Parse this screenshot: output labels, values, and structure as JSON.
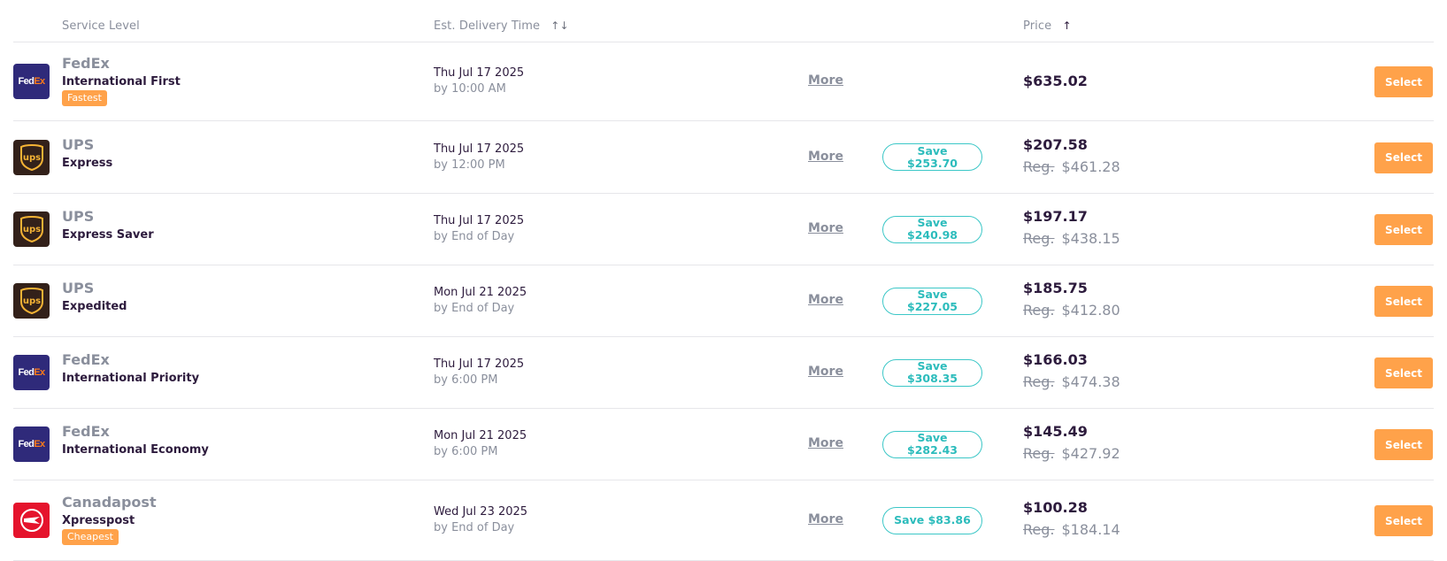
{
  "header": {
    "service_level": "Service Level",
    "est_delivery": "Est. Delivery Time",
    "delivery_sort_icon": "↑↓",
    "price": "Price",
    "price_sort_icon": "↑"
  },
  "colors": {
    "accent_orange": "#ffa24a",
    "save_teal": "#3cc7c7",
    "fedex_purple": "#2f2a7a",
    "ups_brown": "#33211a",
    "canadapost_red": "#e5132c"
  },
  "rows": [
    {
      "carrier": "FedEx",
      "logo": "fedex-logo",
      "service": "International First",
      "badge": "Fastest",
      "date": "Thu Jul 17 2025",
      "time": "by 10:00 AM",
      "more": "More",
      "save": "",
      "price": "$635.02",
      "reg_label": "",
      "reg_price": "",
      "select": "Select"
    },
    {
      "carrier": "UPS",
      "logo": "ups-logo",
      "service": "Express",
      "badge": "",
      "date": "Thu Jul 17 2025",
      "time": "by 12:00 PM",
      "more": "More",
      "save": "Save $253.70",
      "price": "$207.58",
      "reg_label": "Reg.",
      "reg_price": "$461.28",
      "select": "Select"
    },
    {
      "carrier": "UPS",
      "logo": "ups-logo",
      "service": "Express Saver",
      "badge": "",
      "date": "Thu Jul 17 2025",
      "time": "by End of Day",
      "more": "More",
      "save": "Save $240.98",
      "price": "$197.17",
      "reg_label": "Reg.",
      "reg_price": "$438.15",
      "select": "Select"
    },
    {
      "carrier": "UPS",
      "logo": "ups-logo",
      "service": "Expedited",
      "badge": "",
      "date": "Mon Jul 21 2025",
      "time": "by End of Day",
      "more": "More",
      "save": "Save $227.05",
      "price": "$185.75",
      "reg_label": "Reg.",
      "reg_price": "$412.80",
      "select": "Select"
    },
    {
      "carrier": "FedEx",
      "logo": "fedex-logo",
      "service": "International Priority",
      "badge": "",
      "date": "Thu Jul 17 2025",
      "time": "by 6:00 PM",
      "more": "More",
      "save": "Save $308.35",
      "price": "$166.03",
      "reg_label": "Reg.",
      "reg_price": "$474.38",
      "select": "Select"
    },
    {
      "carrier": "FedEx",
      "logo": "fedex-logo",
      "service": "International Economy",
      "badge": "",
      "date": "Mon Jul 21 2025",
      "time": "by 6:00 PM",
      "more": "More",
      "save": "Save $282.43",
      "price": "$145.49",
      "reg_label": "Reg.",
      "reg_price": "$427.92",
      "select": "Select"
    },
    {
      "carrier": "Canadapost",
      "logo": "canadapost-logo",
      "service": "Xpresspost",
      "badge": "Cheapest",
      "date": "Wed Jul 23 2025",
      "time": "by End of Day",
      "more": "More",
      "save": "Save $83.86",
      "price": "$100.28",
      "reg_label": "Reg.",
      "reg_price": "$184.14",
      "select": "Select"
    }
  ]
}
